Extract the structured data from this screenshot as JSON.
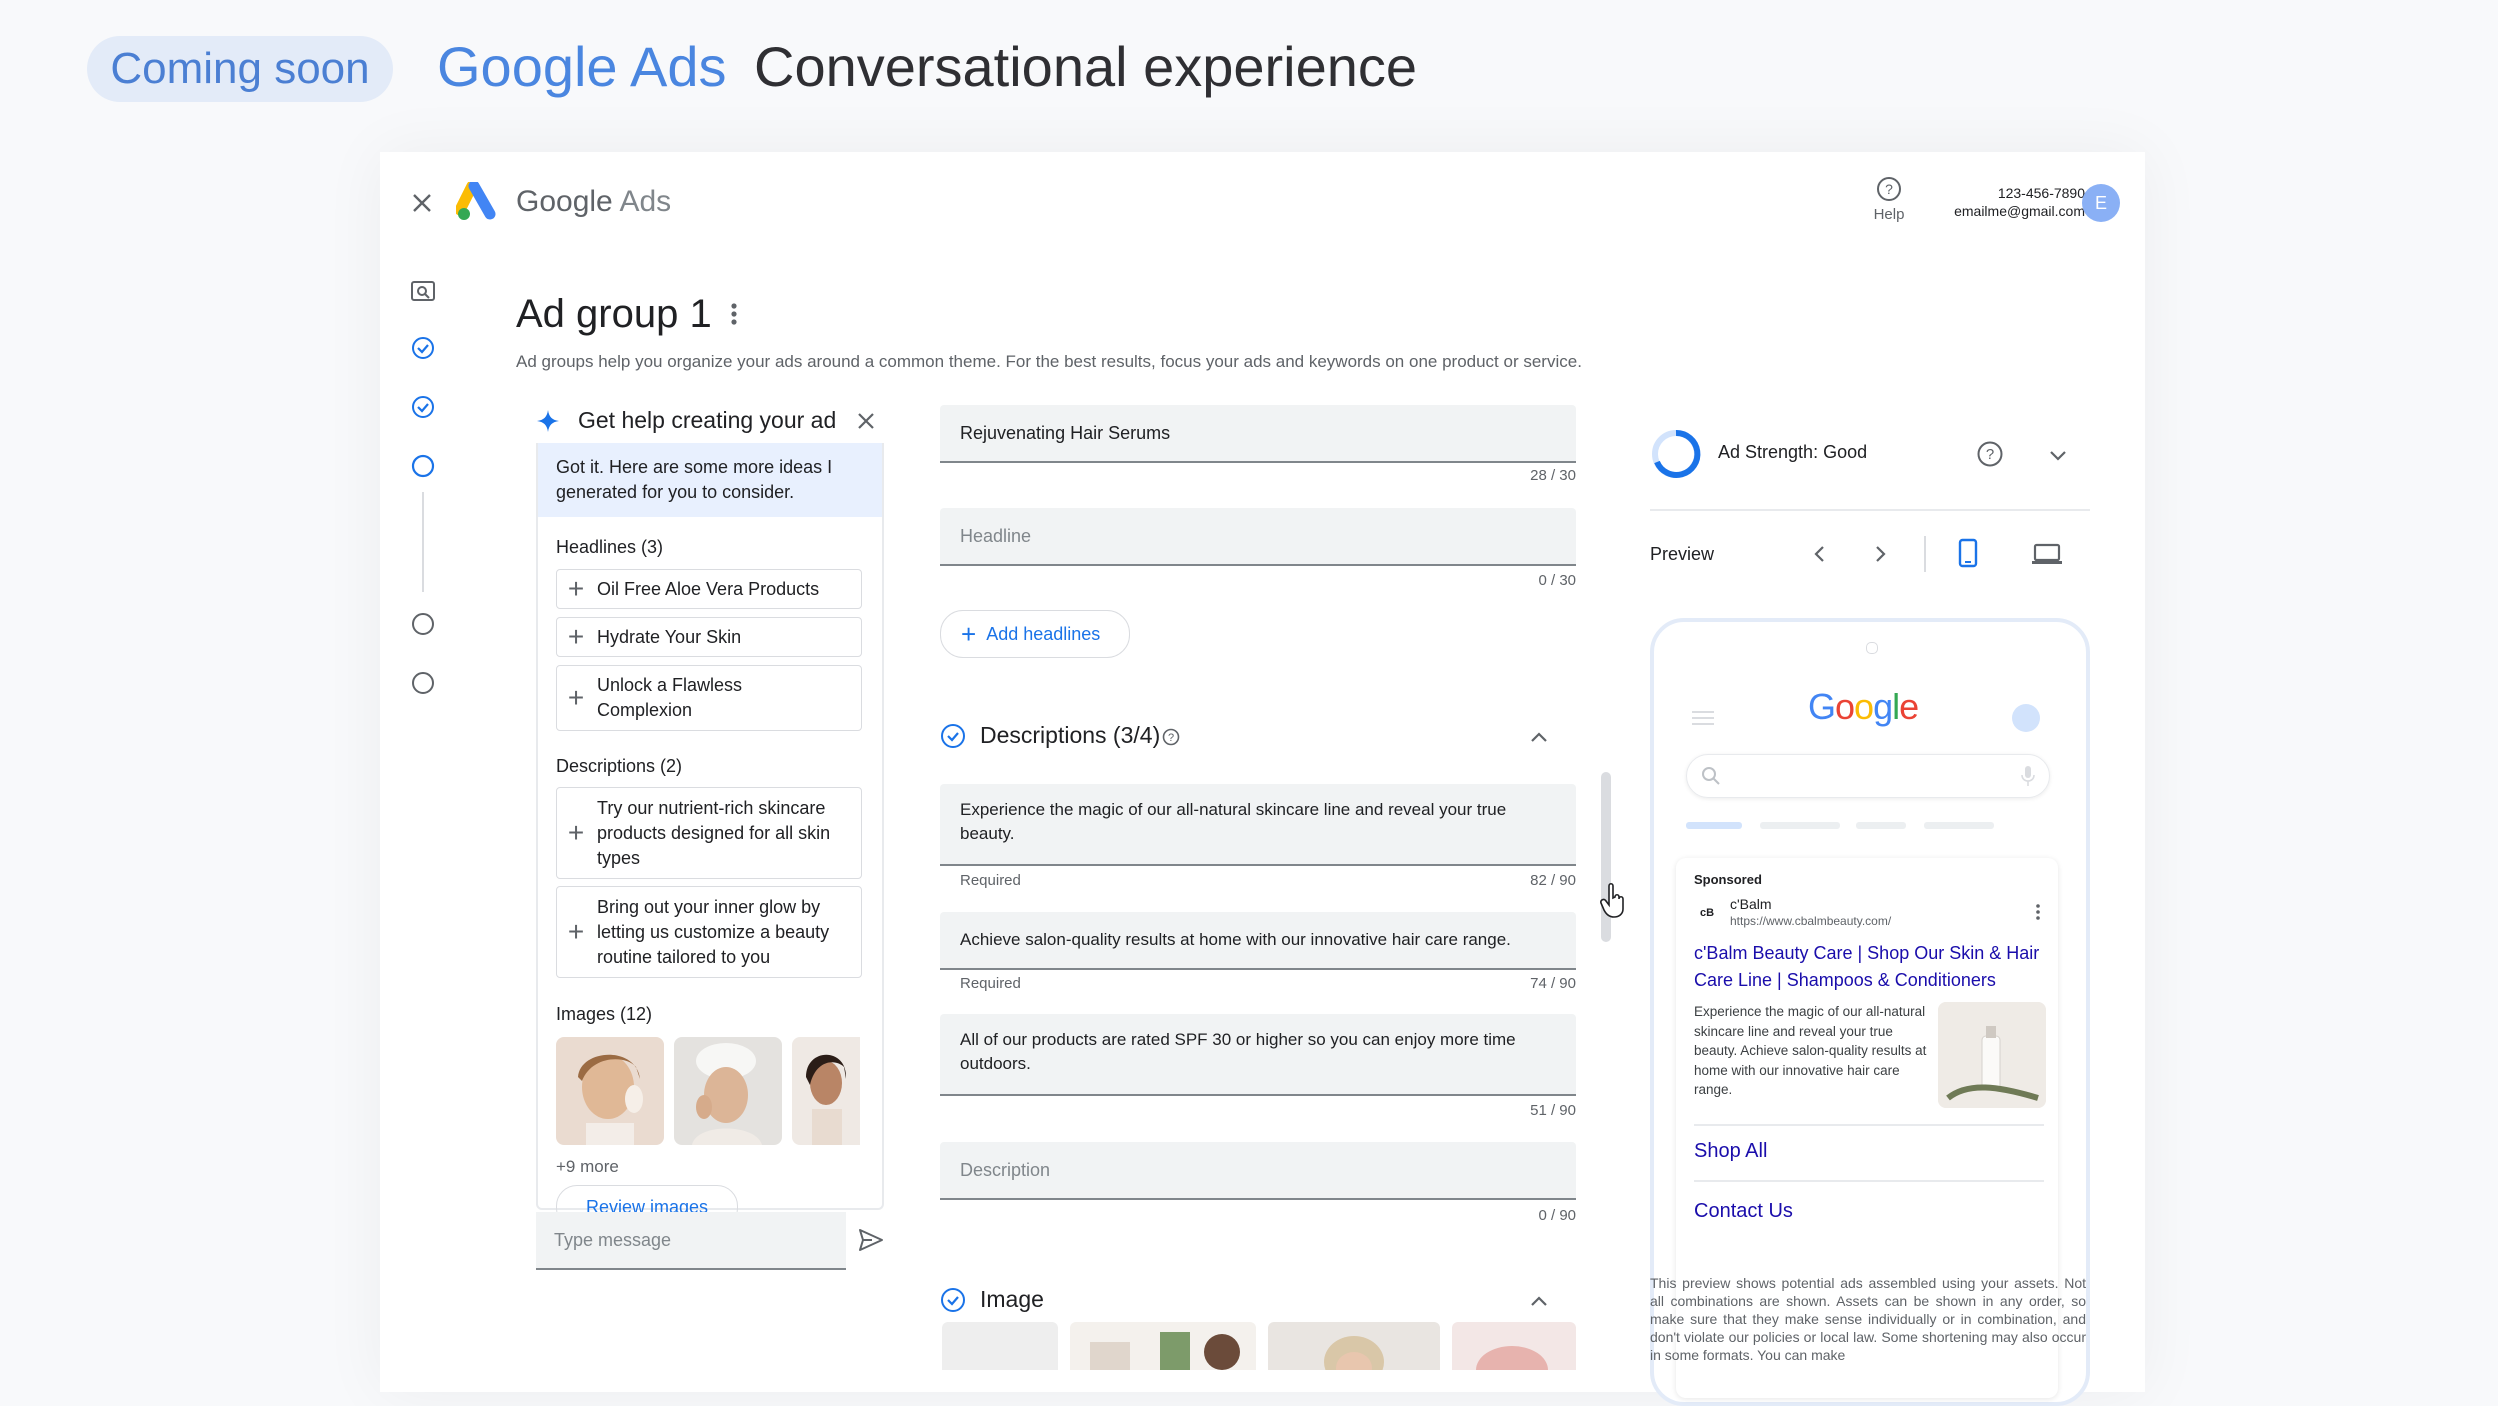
{
  "banner": {
    "badge": "Coming soon",
    "product": "Google Ads",
    "tagline": "Conversational experience"
  },
  "header": {
    "app_name_main": "Google",
    "app_name_sub": "Ads",
    "help_label": "Help",
    "phone": "123-456-7890",
    "email": "emailme@gmail.com",
    "avatar_letter": "E"
  },
  "page": {
    "title": "Ad group 1",
    "subtitle": "Ad groups help you organize your ads around a common theme. For the best results, focus your ads and keywords on one product or service."
  },
  "assistant": {
    "title": "Get help creating your ad",
    "message": "Got it. Here are some more ideas I generated for you to consider.",
    "headlines_title": "Headlines (3)",
    "headlines": [
      "Oil Free Aloe Vera Products",
      "Hydrate Your Skin",
      "Unlock a Flawless Complexion"
    ],
    "descriptions_title": "Descriptions (2)",
    "descriptions": [
      "Try our nutrient-rich skincare products designed for all skin types",
      "Bring out your inner glow by letting us customize a beauty routine tailored to you"
    ],
    "images_title": "Images (12)",
    "more_images": "+9 more",
    "review_button": "Review images",
    "input_placeholder": "Type message"
  },
  "editor": {
    "headline_value": "Rejuvenating Hair Serums",
    "headline_count": "28 / 30",
    "headline_placeholder": "Headline",
    "headline_placeholder_count": "0 / 30",
    "add_headlines": "Add headlines",
    "descriptions_section": "Descriptions (3/4)",
    "descriptions": [
      {
        "text": "Experience the magic of our all-natural skincare line and reveal your true beauty.",
        "note": "Required",
        "count": "82 / 90"
      },
      {
        "text": "Achieve salon-quality results at home with our innovative hair care range.",
        "note": "Required",
        "count": "74 / 90"
      },
      {
        "text": "All of our products are rated SPF 30 or higher so you can enjoy more time outdoors.",
        "note": "",
        "count": "51 / 90"
      }
    ],
    "description_placeholder": "Description",
    "description_placeholder_count": "0 / 90",
    "image_section": "Image"
  },
  "preview": {
    "strength": "Ad Strength: Good",
    "preview_label": "Preview",
    "google_logo": "Google",
    "sponsored": "Sponsored",
    "advertiser": "c'Balm",
    "url": "https://www.cbalmbeauty.com/",
    "ad_title": "c'Balm Beauty Care | Shop Our Skin & Hair Care Line | Shampoos & Conditioners",
    "ad_desc": "Experience the magic of our all-natural skincare line and reveal your true beauty. Achieve salon-quality results at home with our innovative hair care range.",
    "sitelinks": [
      "Shop All",
      "Contact Us"
    ],
    "disclaimer": "This preview shows potential ads assembled using your assets. Not all combinations are shown. Assets can be shown in any order, so make sure that they make sense individually or in combination, and don't violate our policies or local law. Some shortening may also occur in some formats. You can make"
  },
  "colors": {
    "accent": "#1a73e8",
    "banner_blue": "#4a86e0",
    "pill_bg": "#e3ebf8"
  }
}
